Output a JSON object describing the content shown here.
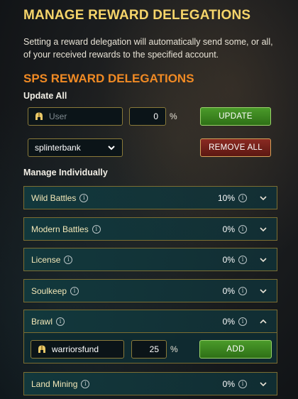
{
  "page": {
    "title": "MANAGE REWARD DELEGATIONS",
    "description": "Setting a reward delegation will automatically send some, or all, of your received rewards to the specified account.",
    "section_title": "SPS REWARD DELEGATIONS"
  },
  "update_all": {
    "label": "Update All",
    "user_placeholder": "User",
    "amount": "0",
    "pct_symbol": "%",
    "update_button": "UPDATE",
    "selected_account": "splinterbank",
    "remove_all_button": "REMOVE ALL"
  },
  "manage": {
    "label": "Manage Individually",
    "info_glyph": "i",
    "rows": [
      {
        "name": "Wild Battles",
        "percent": "10%",
        "expanded": false
      },
      {
        "name": "Modern Battles",
        "percent": "0%",
        "expanded": false
      },
      {
        "name": "License",
        "percent": "0%",
        "expanded": false
      },
      {
        "name": "Soulkeep",
        "percent": "0%",
        "expanded": false
      },
      {
        "name": "Brawl",
        "percent": "0%",
        "expanded": true
      },
      {
        "name": "Land Mining",
        "percent": "0%",
        "expanded": false
      }
    ],
    "brawl_entry": {
      "account": "warriorsfund",
      "amount": "25",
      "pct_symbol": "%",
      "add_button": "ADD"
    }
  },
  "icons": {
    "user_field": "helmet-icon",
    "dropdown": "chevron-down-icon",
    "row_toggle_collapsed": "chevron-down-icon",
    "row_toggle_expanded": "chevron-up-icon",
    "info": "info-icon"
  },
  "colors": {
    "title": "#f5d46a",
    "section_title": "#f08a24",
    "update_button": "#3e8a22",
    "remove_button": "#7a2219",
    "row_bg": "#123a3e",
    "row_border": "#7c6e32"
  }
}
